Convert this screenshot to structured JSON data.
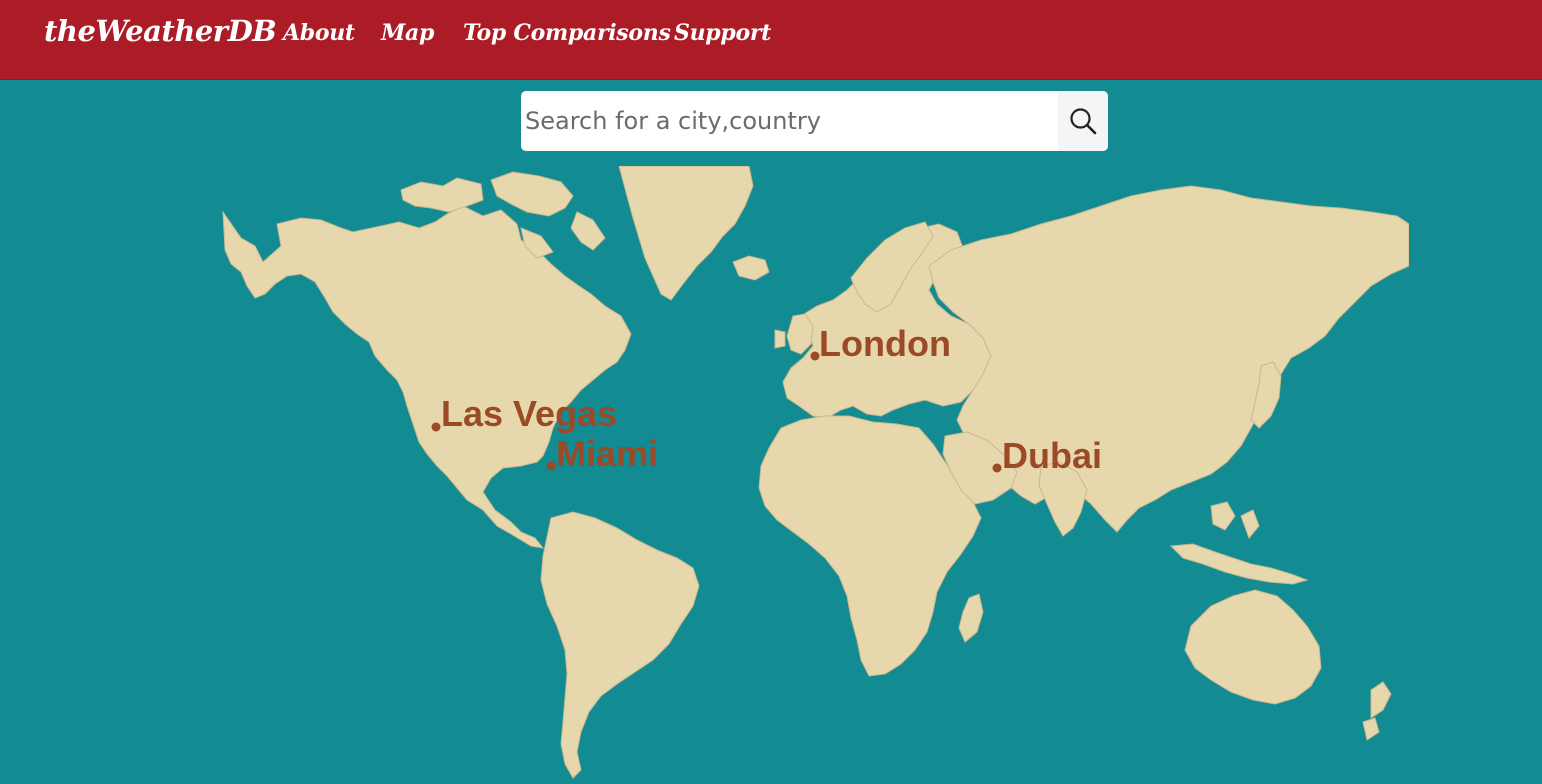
{
  "header": {
    "brand": "theWeatherDB",
    "nav": [
      {
        "label": "About"
      },
      {
        "label": "Map"
      },
      {
        "label": "Top Comparisons"
      },
      {
        "label": "Support"
      }
    ],
    "bg_color": "#ac1c26"
  },
  "search": {
    "placeholder": "Search for a city,country",
    "value": "",
    "icon": "search-icon"
  },
  "map": {
    "ocean_color": "#128b93",
    "land_color": "#e7d7ad",
    "marker_color": "#9b4a26",
    "cities": [
      {
        "name": "London"
      },
      {
        "name": "Las Vegas"
      },
      {
        "name": "Miami"
      },
      {
        "name": "Dubai"
      }
    ]
  }
}
